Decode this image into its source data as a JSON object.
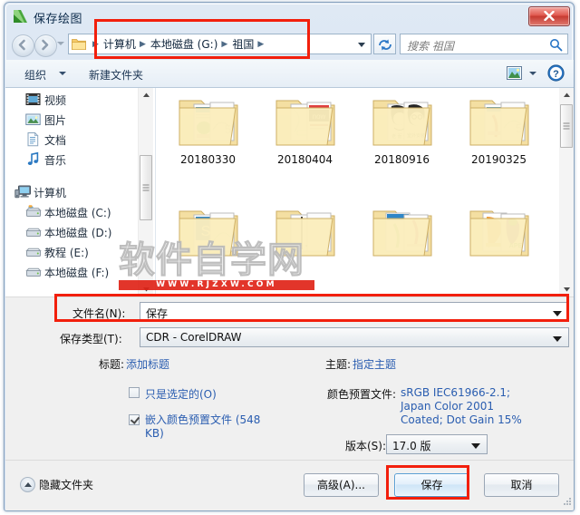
{
  "window": {
    "title": "保存绘图",
    "app_icon": "coreldraw-icon",
    "close_label": "✕"
  },
  "address_bar": {
    "back_tooltip": "后退",
    "forward_tooltip": "前进",
    "folder_icon": "folder-icon",
    "breadcrumbs": [
      "计算机",
      "本地磁盘 (G:)",
      "祖国"
    ],
    "separator": "▶",
    "dropdown_icon": "chevron-down-icon",
    "refresh_icon": "refresh-icon",
    "search_placeholder": "搜索 祖国",
    "search_icon": "search-icon"
  },
  "command_bar": {
    "organize_label": "组织",
    "new_folder_label": "新建文件夹",
    "view_icon": "view-mode-icon",
    "help_icon": "help-icon"
  },
  "nav_pane": {
    "items": [
      {
        "label": "视频",
        "icon": "video-icon",
        "level": "child"
      },
      {
        "label": "图片",
        "icon": "pictures-icon",
        "level": "child"
      },
      {
        "label": "文档",
        "icon": "documents-icon",
        "level": "child"
      },
      {
        "label": "音乐",
        "icon": "music-icon",
        "level": "child"
      },
      {
        "label": "计算机",
        "icon": "computer-icon",
        "level": "root"
      },
      {
        "label": "本地磁盘 (C:)",
        "icon": "system-drive-icon",
        "level": "child"
      },
      {
        "label": "本地磁盘 (D:)",
        "icon": "drive-icon",
        "level": "child"
      },
      {
        "label": "教程 (E:)",
        "icon": "drive-icon",
        "level": "child"
      },
      {
        "label": "本地磁盘 (F:)",
        "icon": "drive-icon",
        "level": "child"
      }
    ]
  },
  "file_list": {
    "folders": [
      {
        "name": "20180330",
        "thumb": "green-doc-thumb"
      },
      {
        "name": "20180404",
        "thumb": "black-label-thumb"
      },
      {
        "name": "20180916",
        "thumb": "portrait-thumb"
      },
      {
        "name": "20190325",
        "thumb": "red-doc-thumb"
      },
      {
        "name": "",
        "thumb": "blue-s-thumb"
      },
      {
        "name": "",
        "thumb": "grey-door-thumb"
      },
      {
        "name": "",
        "thumb": "pink-chart-thumb"
      },
      {
        "name": "",
        "thumb": "orange-purple-thumb"
      }
    ]
  },
  "watermark": {
    "chars": "软件自学网",
    "url": "WWW.RJZXW.COM"
  },
  "form": {
    "filename_label": "文件名(N):",
    "filename_value": "保存",
    "savetype_label": "保存类型(T):",
    "savetype_value": "CDR - CorelDRAW",
    "title_label": "标题:",
    "title_link": "添加标题",
    "subject_label": "主题:",
    "subject_link": "指定主题",
    "only_selected_label": "只是选定的(O)",
    "only_selected_checked": false,
    "embed_profile_label": "嵌入颜色预置文件 (548 KB)",
    "embed_profile_checked": true,
    "color_profile_label": "颜色预置文件:",
    "color_profile_lines": [
      "sRGB IEC61966-2.1;",
      "Japan Color 2001",
      "Coated; Dot Gain 15%"
    ],
    "version_label": "版本(S):",
    "version_value": "17.0 版"
  },
  "footer": {
    "hide_folders_label": "隐藏文件夹",
    "advanced_label": "高级(A)...",
    "save_label": "保存",
    "cancel_label": "取消"
  },
  "annotations": {
    "highlight_color": "#f21f0c",
    "boxes": [
      "address-bar-highlight",
      "filename-highlight",
      "save-button-highlight"
    ]
  }
}
